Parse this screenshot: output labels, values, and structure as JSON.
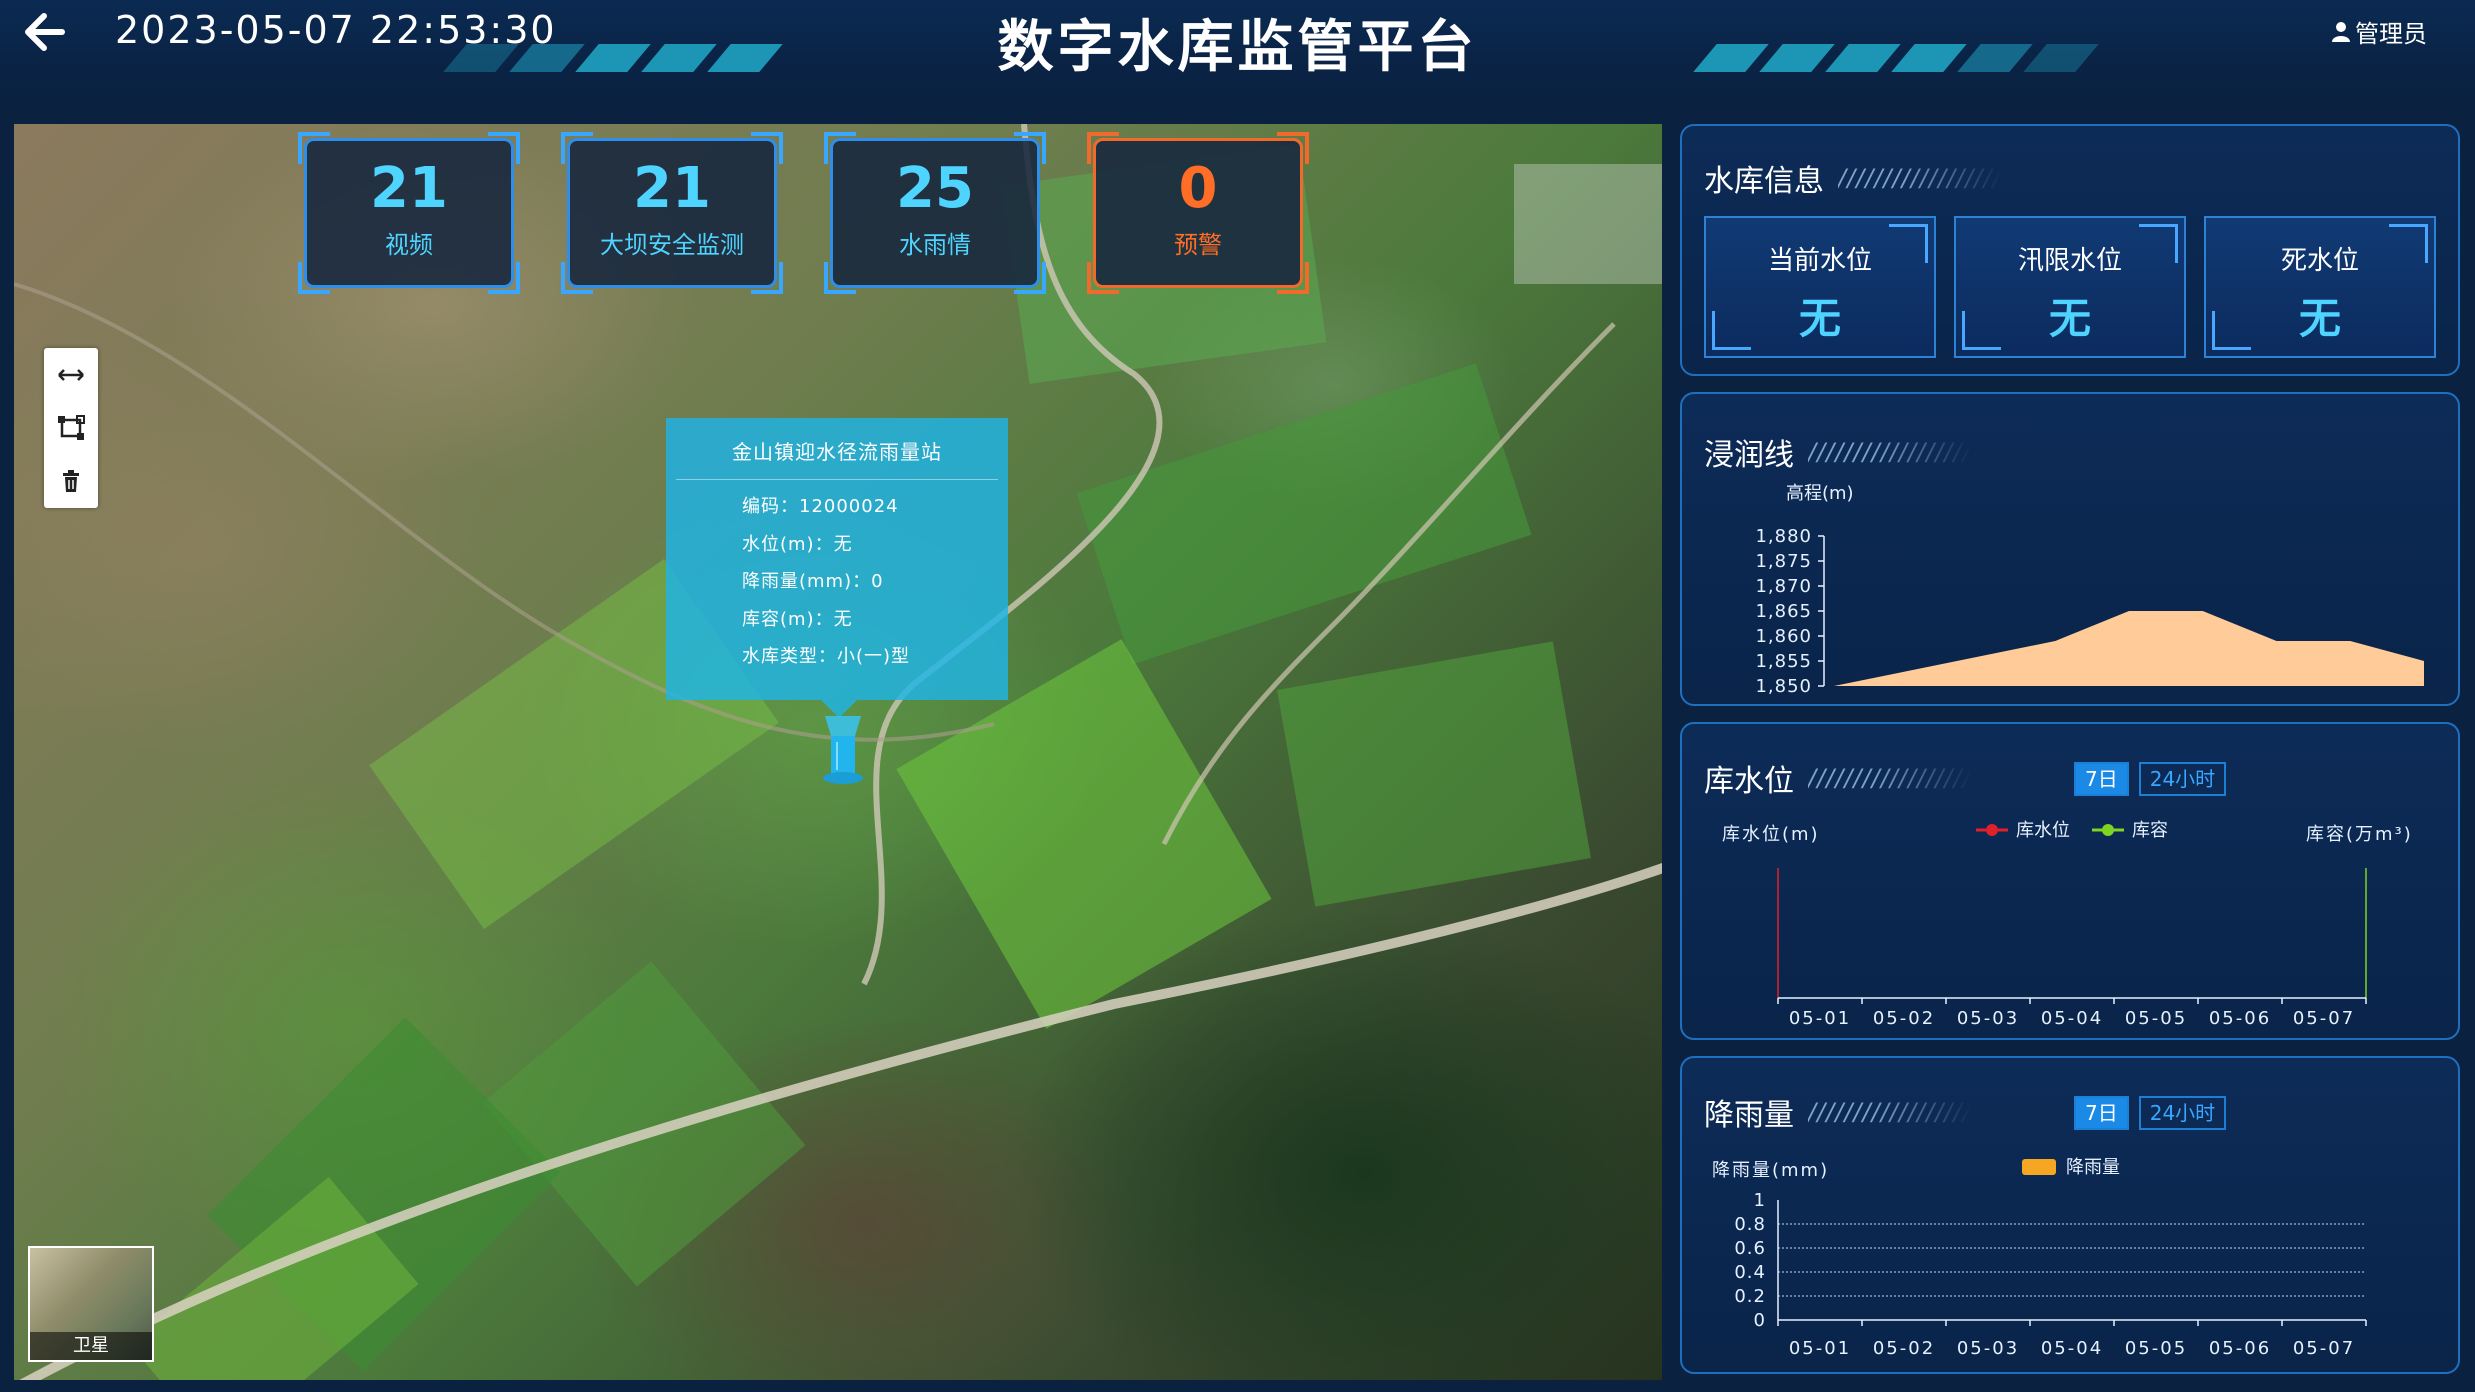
{
  "header": {
    "datetime": "2023-05-07 22:53:30",
    "title": "数字水库监管平台",
    "user": "管理员"
  },
  "stats": [
    {
      "value": "21",
      "label": "视频"
    },
    {
      "value": "21",
      "label": "大坝安全监测"
    },
    {
      "value": "25",
      "label": "水雨情"
    },
    {
      "value": "0",
      "label": "预警"
    }
  ],
  "popup": {
    "title": "金山镇迎水径流雨量站",
    "code": "编码：12000024",
    "water_level": "水位(m)：无",
    "rainfall": "降雨量(mm)：0",
    "capacity": "库容(m)：无",
    "type": "水库类型：小(一)型"
  },
  "basemap": {
    "label": "卫星"
  },
  "reservoir_info": {
    "title": "水库信息",
    "slashes": "//////////////////",
    "cards": [
      {
        "label": "当前水位",
        "value": "无"
      },
      {
        "label": "汛限水位",
        "value": "无"
      },
      {
        "label": "死水位",
        "value": "无"
      }
    ]
  },
  "seepage": {
    "title": "浸润线",
    "slashes": "//////////////////",
    "ylabel": "高程(m)",
    "ticks": [
      "1,880",
      "1,875",
      "1,870",
      "1,865",
      "1,860",
      "1,855",
      "1,850"
    ]
  },
  "water_level": {
    "title": "库水位",
    "slashes": "//////////////////",
    "tabs": [
      "7日",
      "24小时"
    ],
    "ylabel_left": "库水位(m)",
    "ylabel_right": "库容(万m³)",
    "legend": [
      "库水位",
      "库容"
    ],
    "dates": [
      "05-01",
      "05-02",
      "05-03",
      "05-04",
      "05-05",
      "05-06",
      "05-07"
    ]
  },
  "rainfall": {
    "title": "降雨量",
    "slashes": "//////////////////",
    "tabs": [
      "7日",
      "24小时"
    ],
    "ylabel": "降雨量(mm)",
    "legend": "降雨量",
    "ticks": [
      "1",
      "0.8",
      "0.6",
      "0.4",
      "0.2",
      "0"
    ],
    "dates": [
      "05-01",
      "05-02",
      "05-03",
      "05-04",
      "05-05",
      "05-06",
      "05-07"
    ]
  },
  "colors": {
    "accent": "#4fd3ff",
    "warning": "#ff6d26",
    "area": "#ffcc99",
    "level_line": "#e0202a",
    "capacity_line": "#7fd321",
    "rain": "#f5a623"
  },
  "chart_data": [
    {
      "type": "area",
      "ylabel": "高程(m)",
      "ylim": [
        1850,
        1880
      ],
      "x": [
        0,
        1,
        2,
        3,
        4,
        5,
        6,
        7,
        8
      ],
      "values": [
        1850,
        1853,
        1856,
        1859,
        1865,
        1865,
        1859,
        1859,
        1855
      ]
    },
    {
      "type": "line",
      "categories": [
        "05-01",
        "05-02",
        "05-03",
        "05-04",
        "05-05",
        "05-06",
        "05-07"
      ],
      "series": [
        {
          "name": "库水位",
          "values": []
        },
        {
          "name": "库容",
          "values": []
        }
      ],
      "ylabel": "库水位(m)",
      "ylabel_right": "库容(万m³)"
    },
    {
      "type": "bar",
      "categories": [
        "05-01",
        "05-02",
        "05-03",
        "05-04",
        "05-05",
        "05-06",
        "05-07"
      ],
      "series": [
        {
          "name": "降雨量",
          "values": [
            0,
            0,
            0,
            0,
            0,
            0,
            0
          ]
        }
      ],
      "ylabel": "降雨量(mm)",
      "ylim": [
        0,
        1
      ]
    }
  ]
}
